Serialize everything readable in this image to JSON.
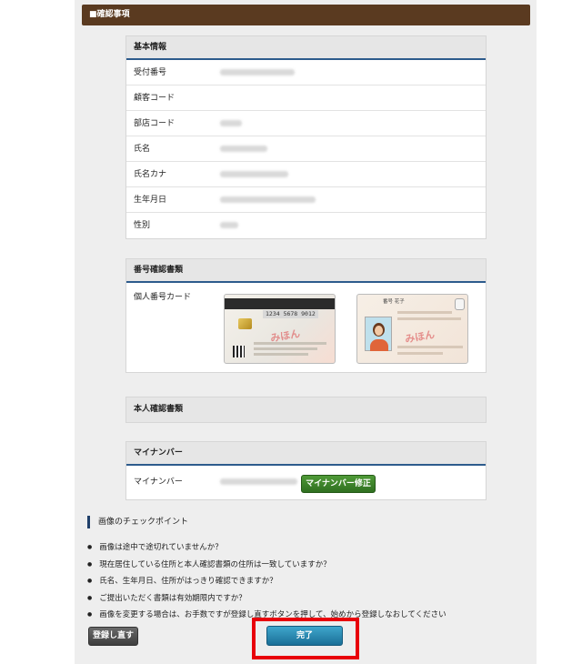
{
  "section_title": "■確認事項",
  "basic_info": {
    "title": "基本情報",
    "rows": [
      {
        "label": "受付番号"
      },
      {
        "label": "顧客コード"
      },
      {
        "label": "部店コード"
      },
      {
        "label": "氏名"
      },
      {
        "label": "氏名カナ"
      },
      {
        "label": "生年月日"
      },
      {
        "label": "性別"
      }
    ]
  },
  "number_docs": {
    "title": "番号確認書類",
    "row_label": "個人番号カード",
    "card_front": {
      "number": "1234 5678 9012",
      "stamp": "みほん"
    },
    "card_back": {
      "name": "番号 花子",
      "stamp": "みほん"
    }
  },
  "identity_docs": {
    "title": "本人確認書類"
  },
  "my_number": {
    "title": "マイナンバー",
    "row_label": "マイナンバー",
    "edit_button": "マイナンバー修正"
  },
  "checkpoints": {
    "title": "画像のチェックポイント",
    "items": [
      "画像は途中で途切れていませんか？",
      "現在居住している住所と本人確認書類の住所は一致していますか？",
      "氏名、生年月日、住所がはっきり確認できますか？",
      "ご提出いただく書類は有効期限内ですか？",
      "画像を変更する場合は、お手数ですが登録し直すボタンを押して、始めから登録しなおしてください"
    ]
  },
  "buttons": {
    "reregister": "登録し直す",
    "complete": "完了"
  },
  "colors": {
    "header_bg": "#5a3a20",
    "accent_line": "#2d5b8c",
    "edit_button": "#3d8a2c",
    "complete_button": "#2a8ab5",
    "highlight": "#e8000a"
  }
}
